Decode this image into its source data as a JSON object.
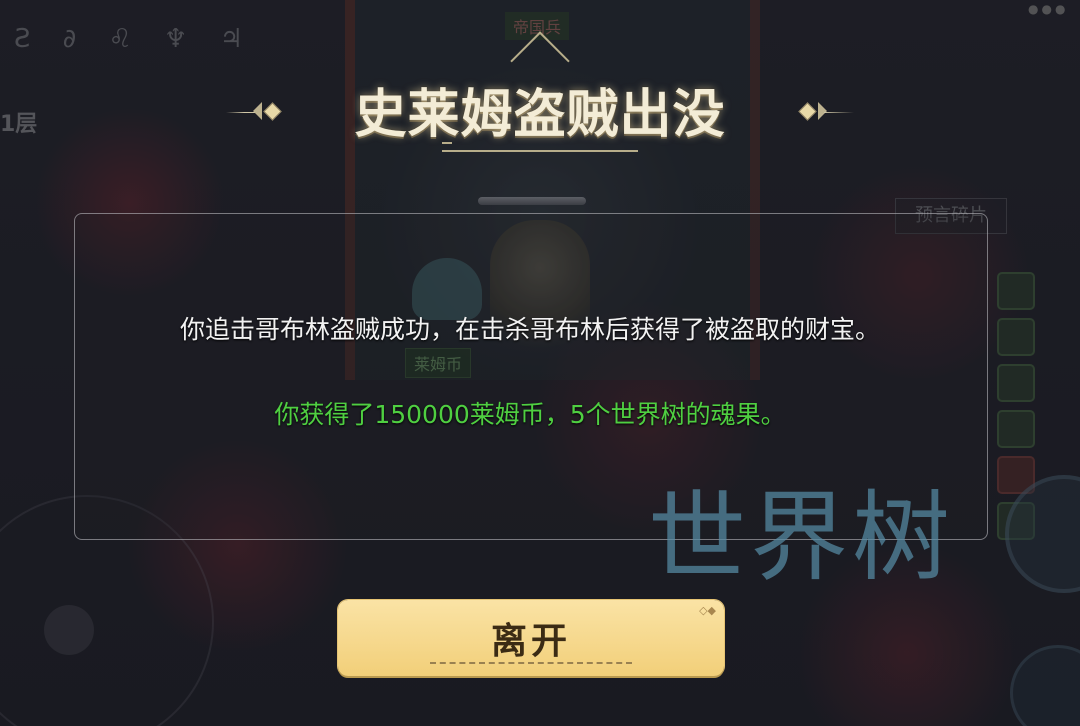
{
  "background": {
    "floor_label": "1层",
    "runes": "Ƨ ∂ ♌ ♆ ♃",
    "prophecy_label": "预言碎片",
    "npc_tag_top": "帝国兵",
    "npc_tag_bottom": "莱姆币"
  },
  "dialog": {
    "title": "史莱姆盗贼出没",
    "message": "你追击哥布林盗贼成功，在击杀哥布林后获得了被盗取的财宝。",
    "reward": "你获得了150000莱姆币，5个世界树的魂果。",
    "leave_button": "离开"
  },
  "watermark": "世界树"
}
